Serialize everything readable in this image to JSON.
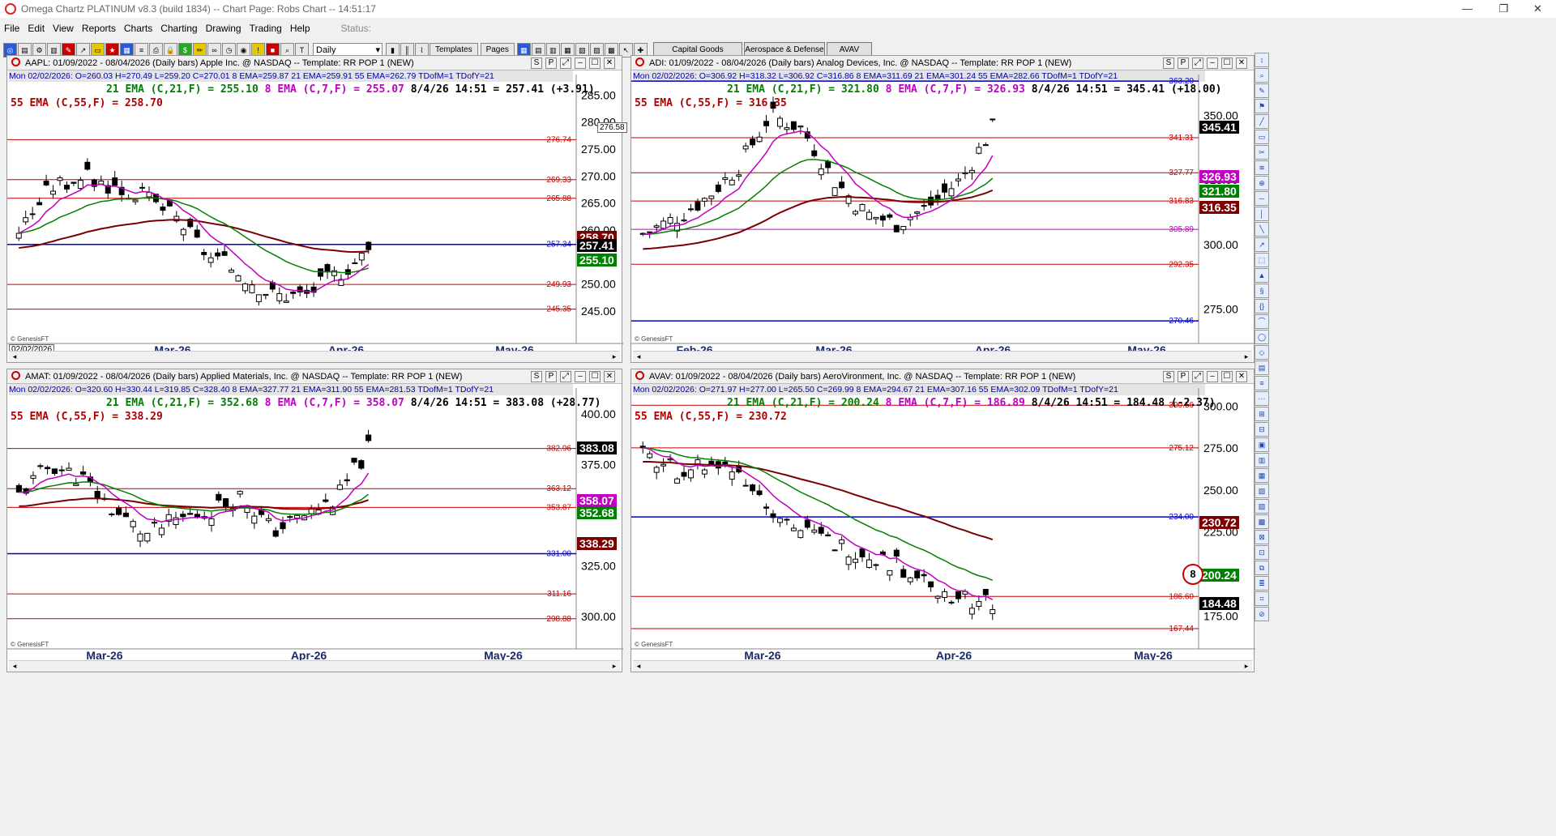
{
  "app_title": "Omega Chartz PLATINUM v8.3 (build 1834)  --  Chart Page: Robs Chart -- 14:51:17",
  "menu": [
    "File",
    "Edit",
    "View",
    "Reports",
    "Charts",
    "Charting",
    "Drawing",
    "Trading",
    "Help"
  ],
  "status_label": "Status:",
  "toolbar": {
    "period": "Daily",
    "templates": "Templates",
    "pages": "Pages",
    "workspaces": [
      "Capital Goods",
      "Aerospace & Defense",
      "AVAV"
    ]
  },
  "header_buttons": [
    "S",
    "P",
    "⤢",
    "–",
    "☐",
    "✕"
  ],
  "charts": [
    {
      "id": "aapl",
      "title": "AAPL: 01/09/2022 - 08/04/2026  (Daily bars)   Apple Inc. @ NASDAQ  --  Template: RR POP 1 (NEW)",
      "ohlc": "Mon   02/02/2026:  O=260.03  H=270.49  L=259.20  C=270.01  8 EMA=259.87  21 EMA=259.91  55 EMA=262.79  TDofM=1  TDofY=21",
      "ema21": "21 EMA (C,21,F) = 255.10",
      "ema8": "8 EMA (C,7,F) = 255.07",
      "last": "8/4/26 14:51 = 257.41 (+3.91)",
      "ema55": "55 EMA (C,55,F) = 258.70",
      "yticks": [
        "285.00",
        "280.00",
        "275.00",
        "270.00",
        "265.00",
        "260.00",
        "255.00",
        "250.00",
        "245.00"
      ],
      "levels": [
        {
          "v": "276.74",
          "c": "#c00000"
        },
        {
          "v": "269.33",
          "c": "#c00000"
        },
        {
          "v": "265.88",
          "c": "#c00000"
        },
        {
          "v": "257.34",
          "c": "#0000cc"
        },
        {
          "v": "249.93",
          "c": "#c00000"
        },
        {
          "v": "245.35",
          "c": "#c00000"
        }
      ],
      "tags": [
        {
          "v": "258.70",
          "c": "#7a0000"
        },
        {
          "v": "257.41",
          "c": "#000000"
        },
        {
          "v": "255.10",
          "c": "#008000"
        }
      ],
      "extra_tag": "276.58",
      "date_box": "02/02/2026",
      "xlabels": [
        "Mar-26",
        "Apr-26",
        "May-26"
      ],
      "watermark": "© GenesisFT"
    },
    {
      "id": "adi",
      "title": "ADI: 01/09/2022 - 08/04/2026  (Daily bars)   Analog Devices, Inc. @ NASDAQ  --  Template: RR POP 1 (NEW)",
      "ohlc": "Mon   02/02/2026:  O=306.92  H=318.32  L=306.92  C=316.86  8 EMA=311.69  21 EMA=301.24  55 EMA=282.66  TDofM=1  TDofY=21",
      "ema21": "21 EMA (C,21,F) = 321.80",
      "ema8": "8 EMA (C,7,F) = 326.93",
      "last": "8/4/26 14:51 = 345.41 (+18.00)",
      "ema55": "55 EMA (C,55,F) = 316.35",
      "yticks": [
        "350.00",
        "325.00",
        "300.00",
        "275.00"
      ],
      "levels": [
        {
          "v": "363.20",
          "c": "#0000cc"
        },
        {
          "v": "341.31",
          "c": "#c00000"
        },
        {
          "v": "327.77",
          "c": "#c00000"
        },
        {
          "v": "316.83",
          "c": "#c00000"
        },
        {
          "v": "305.89",
          "c": "#c000c0"
        },
        {
          "v": "292.35",
          "c": "#c00000"
        },
        {
          "v": "270.46",
          "c": "#0000cc"
        }
      ],
      "tags": [
        {
          "v": "345.41",
          "c": "#000000"
        },
        {
          "v": "326.93",
          "c": "#c000c0"
        },
        {
          "v": "321.80",
          "c": "#008000"
        },
        {
          "v": "316.35",
          "c": "#7a0000"
        }
      ],
      "xlabels": [
        "Feb-26",
        "Mar-26",
        "Apr-26",
        "May-26"
      ],
      "watermark": "© GenesisFT"
    },
    {
      "id": "amat",
      "title": "AMAT: 01/09/2022 - 08/04/2026  (Daily bars)   Applied Materials, Inc. @ NASDAQ  --  Template: RR POP 1 (NEW)",
      "ohlc": "Mon   02/02/2026:  O=320.60  H=330.44  L=319.85  C=328.40  8 EMA=327.77  21 EMA=311.90  55 EMA=281.53  TDofM=1  TDofY=21",
      "ema21": "21 EMA (C,21,F) = 352.68",
      "ema8": "8 EMA (C,7,F) = 358.07",
      "last": "8/4/26 14:51 = 383.08 (+28.77)",
      "ema55": "55 EMA (C,55,F) = 338.29",
      "yticks": [
        "400.00",
        "375.00",
        "350.00",
        "325.00",
        "300.00"
      ],
      "levels": [
        {
          "v": "382.96",
          "c": "#c00000"
        },
        {
          "v": "363.12",
          "c": "#c00000"
        },
        {
          "v": "353.87",
          "c": "#c00000"
        },
        {
          "v": "331.00",
          "c": "#0000cc"
        },
        {
          "v": "311.16",
          "c": "#c00000"
        },
        {
          "v": "298.88",
          "c": "#c00000"
        }
      ],
      "tags": [
        {
          "v": "383.08",
          "c": "#000000"
        },
        {
          "v": "358.07",
          "c": "#c000c0"
        },
        {
          "v": "352.68",
          "c": "#008000"
        },
        {
          "v": "338.29",
          "c": "#7a0000"
        }
      ],
      "xlabels": [
        "Mar-26",
        "Apr-26",
        "May-26"
      ],
      "watermark": "© GenesisFT"
    },
    {
      "id": "avav",
      "title": "AVAV: 01/09/2022 - 08/04/2026  (Daily bars)   AeroVironment, Inc. @ NASDAQ  --  Template: RR POP 1 (NEW)",
      "ohlc": "Mon   02/02/2026:  O=271.97  H=277.00  L=265.50  C=269.99  8 EMA=294.67  21 EMA=307.16  55 EMA=302.09  TDofM=1  TDofY=21",
      "ema21": "21 EMA (C,21,F) = 200.24",
      "ema8": "8 EMA (C,7,F) = 186.89",
      "last": "8/4/26 14:51 = 184.48 (-2.37)",
      "ema55": "55 EMA (C,55,F) = 230.72",
      "yticks": [
        "300.00",
        "275.00",
        "250.00",
        "225.00",
        "200.00",
        "175.00"
      ],
      "levels": [
        {
          "v": "300.56",
          "c": "#c00000"
        },
        {
          "v": "275.12",
          "c": "#c00000"
        },
        {
          "v": "234.00",
          "c": "#0000cc"
        },
        {
          "v": "186.60",
          "c": "#c00000"
        },
        {
          "v": "167.44",
          "c": "#c00000"
        }
      ],
      "tags": [
        {
          "v": "230.72",
          "c": "#7a0000"
        },
        {
          "v": "200.24",
          "c": "#008000"
        },
        {
          "v": "184.48",
          "c": "#000000"
        }
      ],
      "badge": "8",
      "xlabels": [
        "Mar-26",
        "Apr-26",
        "May-26"
      ],
      "watermark": "© GenesisFT"
    }
  ]
}
